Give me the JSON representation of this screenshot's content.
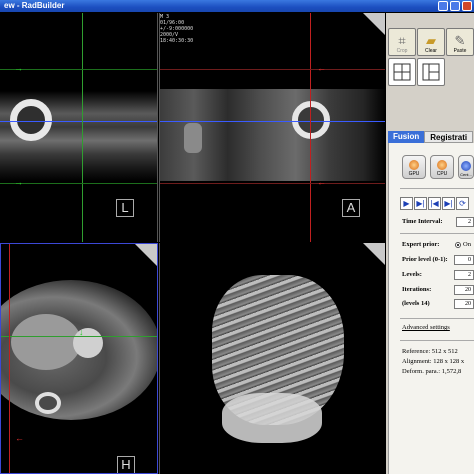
{
  "window": {
    "title": "ew - RadBuilder"
  },
  "viewports": {
    "sagittal": {
      "orientation": "L"
    },
    "coronal": {
      "orientation": "A",
      "info_lines": [
        "M 3",
        "01/96:00",
        "+/-9:000000",
        "2000/V",
        "",
        "18:40:30:30"
      ]
    },
    "axial": {
      "orientation": "H"
    },
    "render3d": {}
  },
  "toolbar": {
    "buttons": [
      {
        "label": "Crop",
        "icon": "crop-icon"
      },
      {
        "label": "Clear",
        "icon": "clear-icon"
      },
      {
        "label": "Paste",
        "icon": "paste-icon"
      }
    ],
    "layout_buttons": [
      "layout-quad-icon",
      "layout-split-icon"
    ]
  },
  "tabs": [
    {
      "label": "Fusion",
      "active": true
    },
    {
      "label": "Registrati",
      "active": false
    }
  ],
  "fusion": {
    "compute_buttons": [
      {
        "label": "GPU"
      },
      {
        "label": "CPU"
      },
      {
        "label": "Cent..."
      }
    ],
    "playback": [
      {
        "icon": "play-icon",
        "glyph": "▶"
      },
      {
        "icon": "step-forward-icon",
        "glyph": "▶|"
      },
      {
        "icon": "rewind-icon",
        "glyph": "|◀"
      },
      {
        "icon": "step-end-icon",
        "glyph": "▶|"
      },
      {
        "icon": "refresh-icon",
        "glyph": "⟳"
      }
    ],
    "time_interval": {
      "label": "Time Interval:",
      "value": "2"
    },
    "expert_prior": {
      "label": "Expert prior:",
      "option": "On"
    },
    "prior_level": {
      "label": "Prior level (0-1):",
      "value": "0"
    },
    "levels": {
      "label": "Levels:",
      "value": "2"
    },
    "iterations": {
      "label": "Iterations:",
      "value": "20"
    },
    "levels_14": {
      "label": "(levels 14)",
      "value": "20"
    },
    "advanced_link": "Advanced settings",
    "summary": {
      "reference": "Reference: 512 x 512",
      "alignment": "Alignment: 128 x 128 x",
      "deform": "Deform. para.: 1,572,8"
    }
  }
}
